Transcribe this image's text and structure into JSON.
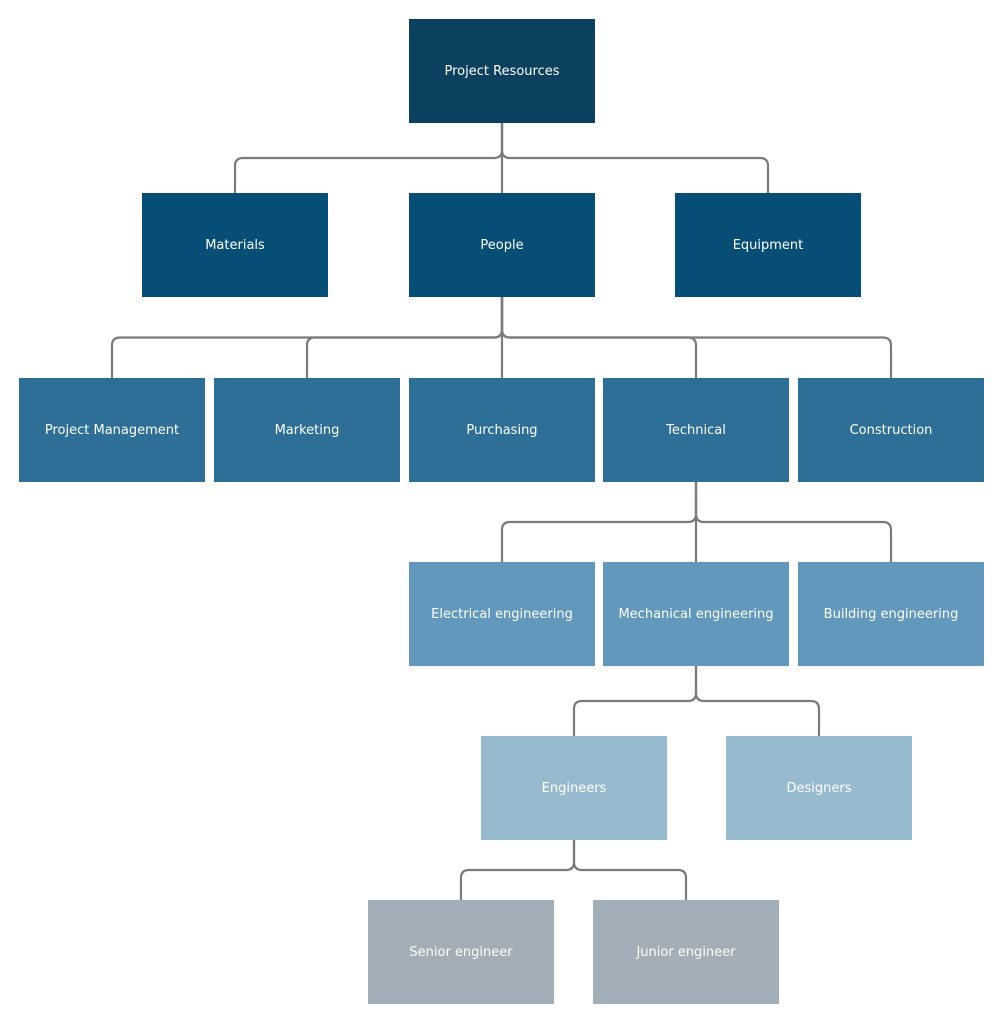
{
  "diagram": {
    "type": "org-chart",
    "nodes": [
      {
        "id": "root",
        "label": "Project Resources",
        "parent": null,
        "level": 0
      },
      {
        "id": "materials",
        "label": "Materials",
        "parent": "root",
        "level": 1
      },
      {
        "id": "people",
        "label": "People",
        "parent": "root",
        "level": 1
      },
      {
        "id": "equipment",
        "label": "Equipment",
        "parent": "root",
        "level": 1
      },
      {
        "id": "project-management",
        "label": "Project Management",
        "parent": "people",
        "level": 2
      },
      {
        "id": "marketing",
        "label": "Marketing",
        "parent": "people",
        "level": 2
      },
      {
        "id": "purchasing",
        "label": "Purchasing",
        "parent": "people",
        "level": 2
      },
      {
        "id": "technical",
        "label": "Technical",
        "parent": "people",
        "level": 2
      },
      {
        "id": "construction",
        "label": "Construction",
        "parent": "people",
        "level": 2
      },
      {
        "id": "electrical-engineering",
        "label": "Electrical engineering",
        "parent": "technical",
        "level": 3
      },
      {
        "id": "mechanical-engineering",
        "label": "Mechanical engineering",
        "parent": "technical",
        "level": 3
      },
      {
        "id": "building-engineering",
        "label": "Building engineering",
        "parent": "technical",
        "level": 3
      },
      {
        "id": "engineers",
        "label": "Engineers",
        "parent": "mechanical-engineering",
        "level": 4
      },
      {
        "id": "designers",
        "label": "Designers",
        "parent": "mechanical-engineering",
        "level": 4
      },
      {
        "id": "senior-engineer",
        "label": "Senior engineer",
        "parent": "engineers",
        "level": 5
      },
      {
        "id": "junior-engineer",
        "label": "Junior engineer",
        "parent": "engineers",
        "level": 5
      }
    ],
    "level_colors": [
      "#0b405e",
      "#074e77",
      "#2e6f97",
      "#6198bb",
      "#98bace",
      "#a2afb8"
    ],
    "connector_color": "#7b7b7b",
    "text_color": "#ffffff"
  }
}
